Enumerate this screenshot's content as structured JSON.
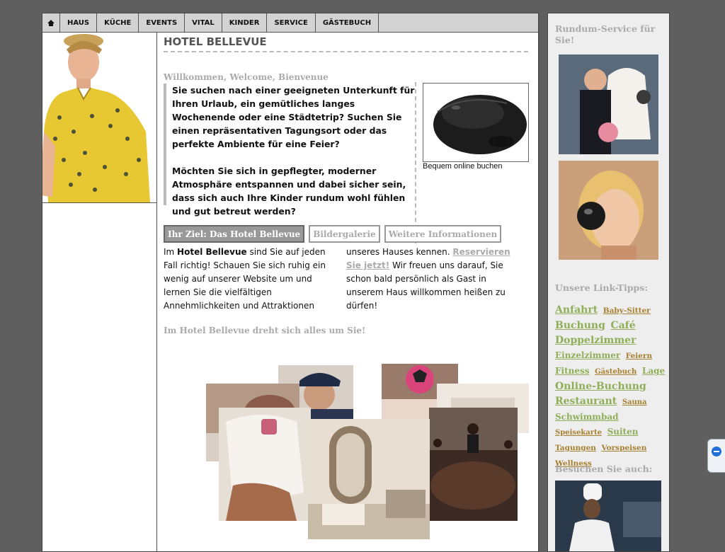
{
  "nav": {
    "home_icon": "home-icon",
    "items": [
      "HAUS",
      "KÜCHE",
      "EVENTS",
      "VITAL",
      "KINDER",
      "SERVICE",
      "GÄSTEBUCH"
    ]
  },
  "main": {
    "title": "HOTEL BELLEVUE",
    "subtitle": "Willkommen, Welcome, Bienvenue",
    "intro_p1": "Sie suchen nach einer geeigneten Unterkunft für Ihren Urlaub, ein gemütliches langes Wochenende oder eine Städtetrip? Suchen Sie einen repräsentativen Tagungsort oder das perfekte Ambiente für eine Feier?",
    "intro_p2": "Möchten Sie sich in gepflegter, moderner Atmosphäre entspannen und dabei sicher sein, dass sich auch Ihre Kinder rundum wohl fühlen und gut betreut werden?",
    "mouse_caption": "Bequem online buchen",
    "tabs": [
      "Ihr Ziel: Das Hotel Bellevue",
      "Bildergalerie",
      "Weitere Informationen"
    ],
    "body_pre": "Im ",
    "body_bold": "Hotel Bellevue",
    "body_mid": " sind Sie auf jeden Fall richtig! Schauen Sie sich ruhig ein wenig auf unserer Website um und lernen Sie die vielfältigen Annehmlichkeiten und Attraktionen",
    "body_col2_pre": "unseres Hauses kennen. ",
    "reserve_link": "Reservieren Sie jetzt!",
    "body_col2_post": " Wir freuen uns darauf, Sie schon bald persönlich als Gast in unserem Haus willkommen heißen zu dürfen!",
    "tagline": "Im Hotel Bellevue dreht sich alles um Sie!"
  },
  "sidebar": {
    "service_heading": "Rundum-Service für Sie!",
    "links_heading": "Unsere Link-Tipps:",
    "visit_heading": "Besuchen Sie auch:",
    "tags": [
      {
        "label": "Anfahrt",
        "size": "l"
      },
      {
        "label": "Baby-Sitter",
        "size": "s"
      },
      {
        "label": "Buchung",
        "size": "l"
      },
      {
        "label": "Café",
        "size": "l"
      },
      {
        "label": "Doppelzimmer",
        "size": "l"
      },
      {
        "label": "Einzelzimmer",
        "size": "m"
      },
      {
        "label": "Feiern",
        "size": "s"
      },
      {
        "label": "Fitness",
        "size": "m"
      },
      {
        "label": "Gästebuch",
        "size": "xs"
      },
      {
        "label": "Lage",
        "size": "m"
      },
      {
        "label": "Online-Buchung",
        "size": "l"
      },
      {
        "label": "Restaurant",
        "size": "l"
      },
      {
        "label": "Sauna",
        "size": "xs"
      },
      {
        "label": "Schwimmbad",
        "size": "m"
      },
      {
        "label": "Speisekarte",
        "size": "xs"
      },
      {
        "label": "Suiten",
        "size": "m"
      },
      {
        "label": "Tagungen",
        "size": "s"
      },
      {
        "label": "Vorspeisen",
        "size": "s"
      },
      {
        "label": "Wellness",
        "size": "s"
      }
    ]
  },
  "colors": {
    "tag_green": "#8fae58",
    "tag_brown": "#a7802f",
    "heading_grey": "#aaaaaa"
  }
}
